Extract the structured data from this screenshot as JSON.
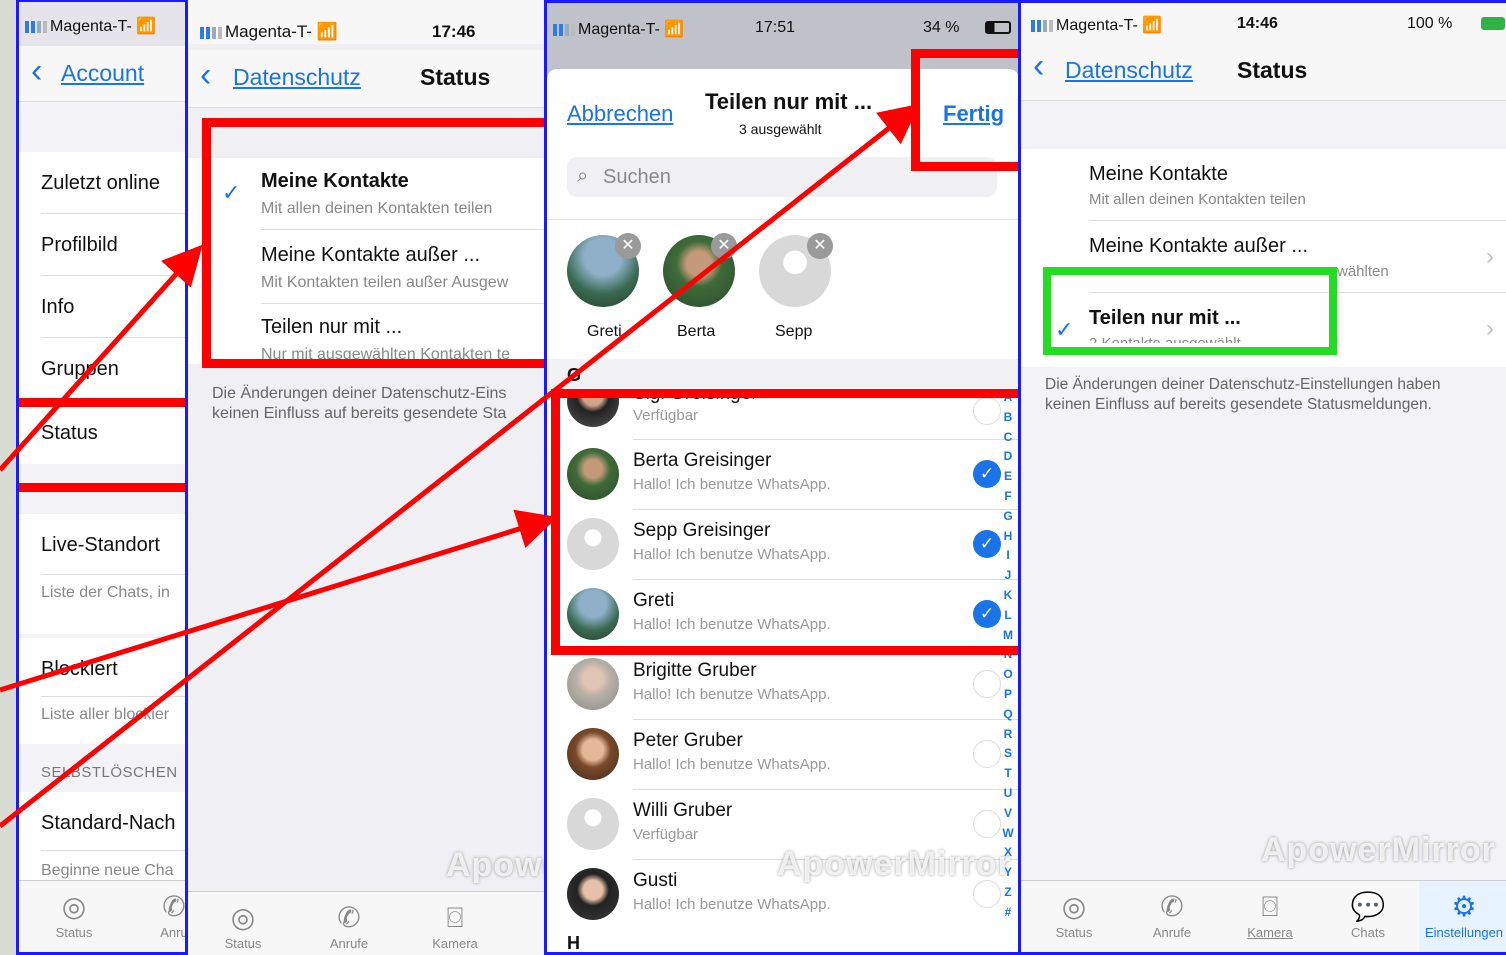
{
  "colors": {
    "accent": "#1a73e8",
    "highlight_red": "#ff0000",
    "highlight_green": "#22dd22",
    "frame_blue": "#1a1aff"
  },
  "p1": {
    "carrier": "Magenta-T-",
    "back_label": "Account",
    "rows": [
      "Zuletzt online",
      "Profilbild",
      "Info",
      "Gruppen",
      "Status"
    ],
    "live": "Live-Standort",
    "live_sub": "Liste der Chats, in",
    "blocked": "Blockiert",
    "blocked_sub": "Liste aller blockier",
    "section": "SELBSTLÖSCHEN",
    "standard": "Standard-Nach",
    "standard_sub": "Beginne neue Cha",
    "tabs": [
      "Status",
      "Anru"
    ]
  },
  "p2": {
    "carrier": "Magenta-T-",
    "time": "17:46",
    "back_label": "Datenschutz",
    "title": "Status",
    "opt1": "Meine Kontakte",
    "opt1_sub": "Mit allen deinen Kontakten teilen",
    "opt2": "Meine Kontakte außer ...",
    "opt2_sub": "Mit Kontakten teilen außer Ausgew",
    "opt3": "Teilen nur mit ...",
    "opt3_sub": "Nur mit ausgewählten Kontakten te",
    "note": "Die Änderungen deiner Datenschutz-Eins keinen Einfluss auf bereits gesendete Sta",
    "tabs": [
      "Status",
      "Anrufe",
      "Kamera"
    ],
    "watermark": "Apowe"
  },
  "p3": {
    "carrier": "Magenta-T-",
    "time": "17:51",
    "battery": "34 %",
    "cancel": "Abbrechen",
    "title": "Teilen nur mit ...",
    "subtitle": "3 ausgewählt",
    "done": "Fertig",
    "search_placeholder": "Suchen",
    "selected": [
      "Greti",
      "Berta",
      "Sepp"
    ],
    "section_g": "G",
    "section_h": "H",
    "contacts": [
      {
        "name": "Sigi Greisinger",
        "status": "Verfügbar",
        "checked": false
      },
      {
        "name": "Berta Greisinger",
        "status": "Hallo! Ich benutze WhatsApp.",
        "checked": true
      },
      {
        "name": "Sepp Greisinger",
        "status": "Hallo! Ich benutze WhatsApp.",
        "checked": true
      },
      {
        "name": "Greti",
        "status": "Hallo! Ich benutze WhatsApp.",
        "checked": true
      },
      {
        "name": "Brigitte Gruber",
        "status": "Hallo! Ich benutze WhatsApp.",
        "checked": false
      },
      {
        "name": "Peter Gruber",
        "status": "Hallo! Ich benutze WhatsApp.",
        "checked": false
      },
      {
        "name": "Willi Gruber",
        "status": "Verfügbar",
        "checked": false
      },
      {
        "name": "Gusti",
        "status": "Hallo! Ich benutze WhatsApp.",
        "checked": false
      }
    ],
    "index_letters": [
      "A",
      "B",
      "C",
      "D",
      "E",
      "F",
      "G",
      "H",
      "I",
      "J",
      "K",
      "L",
      "M",
      "N",
      "O",
      "P",
      "Q",
      "R",
      "S",
      "T",
      "U",
      "V",
      "W",
      "X",
      "Y",
      "Z",
      "#"
    ],
    "watermark": "ApowerMirror"
  },
  "p4": {
    "carrier": "Magenta-T-",
    "time": "14:46",
    "battery": "100 %",
    "back_label": "Datenschutz",
    "title": "Status",
    "opt1": "Meine Kontakte",
    "opt1_sub": "Mit allen deinen Kontakten teilen",
    "opt2": "Meine Kontakte außer ...",
    "opt2_sub": "wählten",
    "opt3": "Teilen nur mit ...",
    "opt3_sub": "2 Kontakte ausgewählt",
    "note": "Die Änderungen deiner Datenschutz-Einstellungen haben keinen Einfluss auf bereits gesendete Statusmeldungen.",
    "tabs": [
      "Status",
      "Anrufe",
      "Kamera",
      "Chats",
      "Einstellungen"
    ],
    "watermark": "ApowerMirror"
  }
}
